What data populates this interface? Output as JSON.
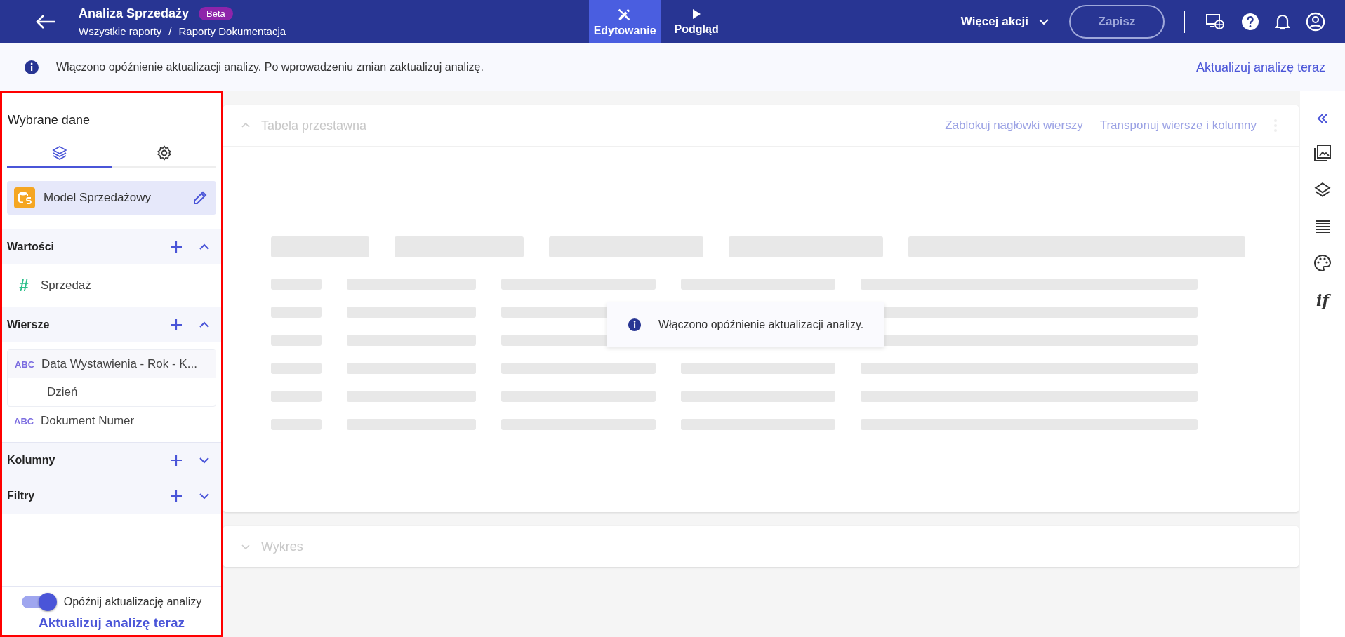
{
  "header": {
    "title": "Analiza Sprzedaży",
    "badge": "Beta",
    "breadcrumbs": [
      "Wszystkie raporty",
      "Raporty Dokumentacja"
    ],
    "separator": "/"
  },
  "modes": [
    {
      "label": "Edytowanie",
      "kind": "edit",
      "selected": true
    },
    {
      "label": "Podgląd",
      "kind": "preview",
      "selected": false
    }
  ],
  "actions": {
    "more": "Więcej akcji",
    "save": "Zapisz",
    "save_disabled": true
  },
  "banner": {
    "text": "Włączono opóźnienie aktualizacji analizy. Po wprowadzeniu zmian zaktualizuj analizę.",
    "link": "Aktualizuj analizę teraz"
  },
  "sidebar": {
    "title": "Wybrane dane",
    "tabs": [
      {
        "kind": "layers",
        "selected": true
      },
      {
        "kind": "settings",
        "selected": false
      }
    ],
    "model": "Model Sprzedażowy",
    "sections": [
      {
        "title": "Wartości",
        "expanded": true,
        "items": [
          {
            "kind": "number",
            "type_label": "#",
            "label": "Sprzedaż"
          }
        ]
      },
      {
        "title": "Wiersze",
        "expanded": true,
        "items": [
          {
            "kind": "text",
            "type_label": "ABC",
            "label": "Data Wystawienia - Rok - K...",
            "children": [
              {
                "label": "Dzień"
              }
            ]
          },
          {
            "kind": "text",
            "type_label": "ABC",
            "label": "Dokument Numer"
          }
        ]
      },
      {
        "title": "Kolumny",
        "expanded": false
      },
      {
        "title": "Filtry",
        "expanded": false
      }
    ],
    "toggle": {
      "label": "Opóźnij aktualizację analizy",
      "on": true
    },
    "link": "Aktualizuj analizę teraz"
  },
  "pivot": {
    "title": "Tabela przestawna",
    "expanded": true,
    "actions": [
      "Zablokuj nagłówki wierszy",
      "Transponuj wiersze i kolumny"
    ],
    "toast": "Włączono opóźnienie aktualizacji analizy."
  },
  "chart_panel": {
    "title": "Wykres",
    "expanded": false
  },
  "rail": {
    "formula_label": "if"
  }
}
